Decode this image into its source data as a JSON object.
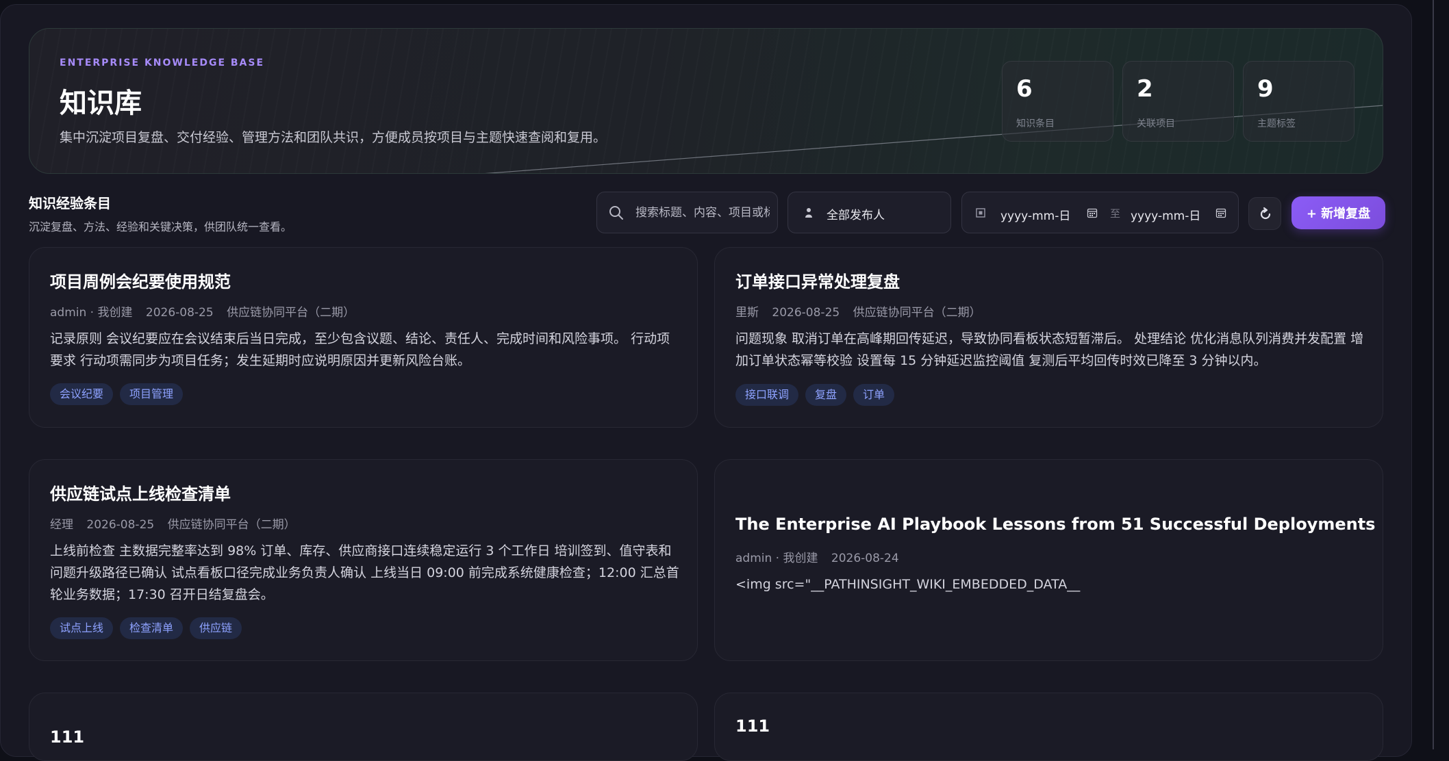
{
  "hero": {
    "eyebrow": "ENTERPRISE KNOWLEDGE BASE",
    "title": "知识库",
    "description": "集中沉淀项目复盘、交付经验、管理方法和团队共识，方便成员按项目与主题快速查阅和复用。",
    "stats": [
      {
        "value": "6",
        "label": "知识条目"
      },
      {
        "value": "2",
        "label": "关联项目"
      },
      {
        "value": "9",
        "label": "主题标签"
      }
    ]
  },
  "section": {
    "title": "知识经验条目",
    "subtitle": "沉淀复盘、方法、经验和关键决策，供团队统一查看。"
  },
  "filters": {
    "search_placeholder": "搜索标题、内容、项目或标签",
    "author_label": "全部发布人",
    "date_start": "yyyy-mm-日",
    "date_separator": "至",
    "date_end": "yyyy-mm-日",
    "refresh_glyph": "↺",
    "add_button_label": "+ 新增复盘"
  },
  "cards": [
    {
      "title": "项目周例会纪要使用规范",
      "meta": [
        "admin · 我创建",
        "2026-08-25",
        "供应链协同平台（二期）"
      ],
      "body": "记录原则 会议纪要应在会议结束后当日完成，至少包含议题、结论、责任人、完成时间和风险事项。 行动项要求 行动项需同步为项目任务；发生延期时应说明原因并更新风险台账。",
      "tags": [
        "会议纪要",
        "项目管理"
      ]
    },
    {
      "title": "订单接口异常处理复盘",
      "meta": [
        "里斯",
        "2026-08-25",
        "供应链协同平台（二期）"
      ],
      "body": "问题现象 取消订单在高峰期回传延迟，导致协同看板状态短暂滞后。 处理结论 优化消息队列消费并发配置 增加订单状态幂等校验 设置每 15 分钟延迟监控阈值 复测后平均回传时效已降至 3 分钟以内。",
      "tags": [
        "接口联调",
        "复盘",
        "订单"
      ]
    },
    {
      "title": "供应链试点上线检查清单",
      "meta": [
        "经理",
        "2026-08-25",
        "供应链协同平台（二期）"
      ],
      "body": "上线前检查 主数据完整率达到 98% 订单、库存、供应商接口连续稳定运行 3 个工作日 培训签到、值守表和问题升级路径已确认 试点看板口径完成业务负责人确认 上线当日 09:00 前完成系统健康检查；12:00 汇总首轮业务数据；17:30 召开日结复盘会。",
      "tags": [
        "试点上线",
        "检查清单",
        "供应链"
      ]
    },
    {
      "title": "The Enterprise AI Playbook Lessons from 51 Successful Deployments",
      "meta": [
        "admin · 我创建",
        "2026-08-24"
      ],
      "body": "<img src=\"__PATHINSIGHT_WIKI_EMBEDDED_DATA__",
      "tags": []
    },
    {
      "title": "111",
      "meta": [],
      "body": "",
      "tags": []
    },
    {
      "title": "111",
      "meta": [],
      "body": "",
      "tags": []
    }
  ]
}
